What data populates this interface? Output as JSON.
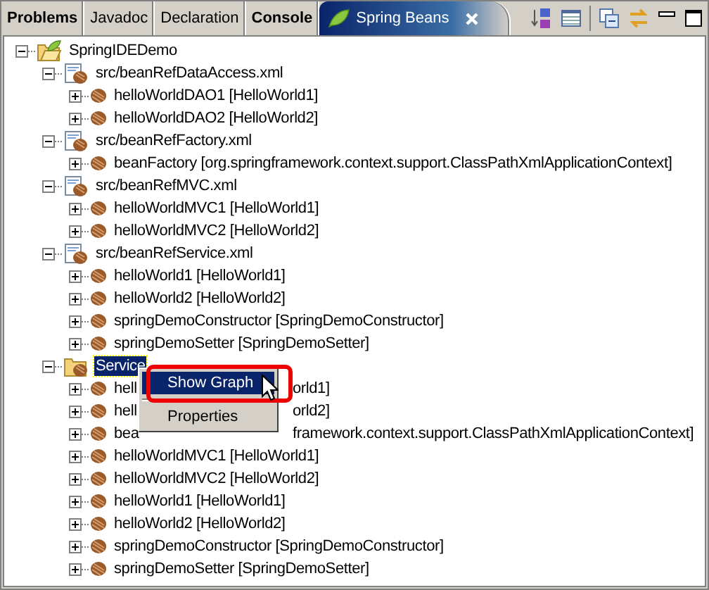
{
  "tabs": [
    {
      "label": "Problems",
      "bold": true,
      "selected": false
    },
    {
      "label": "Javadoc",
      "bold": false,
      "selected": false
    },
    {
      "label": "Declaration",
      "bold": false,
      "selected": false
    },
    {
      "label": "Console",
      "bold": true,
      "selected": false
    },
    {
      "label": "Spring Beans",
      "bold": false,
      "selected": true
    }
  ],
  "tree": {
    "label": "SpringIDEDemo",
    "kind": "project",
    "expanded": true,
    "selected": false,
    "children": [
      {
        "label": "src/beanRefDataAccess.xml",
        "kind": "config",
        "expanded": true,
        "selected": false,
        "children": [
          {
            "label": "helloWorldDAO1 [HelloWorld1]",
            "kind": "bean",
            "expanded": false,
            "selected": false
          },
          {
            "label": "helloWorldDAO2 [HelloWorld2]",
            "kind": "bean",
            "expanded": false,
            "selected": false
          }
        ]
      },
      {
        "label": "src/beanRefFactory.xml",
        "kind": "config",
        "expanded": true,
        "selected": false,
        "children": [
          {
            "label": "beanFactory [org.springframework.context.support.ClassPathXmlApplicationContext]",
            "kind": "bean",
            "expanded": false,
            "selected": false
          }
        ]
      },
      {
        "label": "src/beanRefMVC.xml",
        "kind": "config",
        "expanded": true,
        "selected": false,
        "children": [
          {
            "label": "helloWorldMVC1 [HelloWorld1]",
            "kind": "bean",
            "expanded": false,
            "selected": false
          },
          {
            "label": "helloWorldMVC2 [HelloWorld2]",
            "kind": "bean",
            "expanded": false,
            "selected": false
          }
        ]
      },
      {
        "label": "src/beanRefService.xml",
        "kind": "config",
        "expanded": true,
        "selected": false,
        "children": [
          {
            "label": "helloWorld1 [HelloWorld1]",
            "kind": "bean",
            "expanded": false,
            "selected": false
          },
          {
            "label": "helloWorld2 [HelloWorld2]",
            "kind": "bean",
            "expanded": false,
            "selected": false
          },
          {
            "label": "springDemoConstructor [SpringDemoConstructor]",
            "kind": "bean",
            "expanded": false,
            "selected": false
          },
          {
            "label": "springDemoSetter [SpringDemoSetter]",
            "kind": "bean",
            "expanded": false,
            "selected": false
          }
        ]
      },
      {
        "label": "Service",
        "kind": "folder",
        "expanded": true,
        "selected": true,
        "children": [
          {
            "label": "hell",
            "label_right": "orld1]",
            "kind": "bean",
            "expanded": false,
            "selected": false
          },
          {
            "label": "hell",
            "label_right": "orld2]",
            "kind": "bean",
            "expanded": false,
            "selected": false
          },
          {
            "label": "bea",
            "label_right": "framework.context.support.ClassPathXmlApplicationContext]",
            "kind": "bean",
            "expanded": false,
            "selected": false
          },
          {
            "label": "helloWorldMVC1 [HelloWorld1]",
            "kind": "bean",
            "expanded": false,
            "selected": false
          },
          {
            "label": "helloWorldMVC2 [HelloWorld2]",
            "kind": "bean",
            "expanded": false,
            "selected": false
          },
          {
            "label": "helloWorld1 [HelloWorld1]",
            "kind": "bean",
            "expanded": false,
            "selected": false
          },
          {
            "label": "helloWorld2 [HelloWorld2]",
            "kind": "bean",
            "expanded": false,
            "selected": false
          },
          {
            "label": "springDemoConstructor [SpringDemoConstructor]",
            "kind": "bean",
            "expanded": false,
            "selected": false
          },
          {
            "label": "springDemoSetter [SpringDemoSetter]",
            "kind": "bean",
            "expanded": false,
            "selected": false
          }
        ]
      }
    ]
  },
  "context_menu": {
    "items": [
      {
        "label": "Show Graph",
        "selected": true
      },
      {
        "label": "Properties",
        "selected": false
      }
    ]
  }
}
